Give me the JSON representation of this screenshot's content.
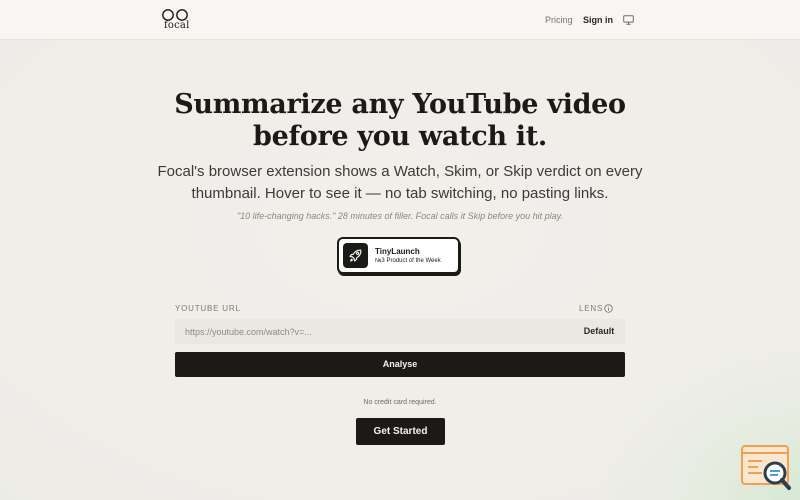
{
  "header": {
    "logo_text": "focal",
    "nav": {
      "pricing": "Pricing",
      "sign_in": "Sign in"
    },
    "theme_icon": "monitor-icon"
  },
  "hero": {
    "headline_line1": "Summarize any YouTube video",
    "headline_line2": "before you watch it.",
    "subhead_line1": "Focal's browser extension shows a Watch, Skim, or Skip verdict on every",
    "subhead_line2": "thumbnail. Hover to see it — no tab switching, no pasting links.",
    "quote": "\"10 life-changing hacks.\" 28 minutes of filler. Focal calls it Skip before you hit play."
  },
  "badge": {
    "title": "TinyLaunch",
    "subtitle": "№3 Product of the Week",
    "icon": "rocket-icon"
  },
  "form": {
    "url_label": "YOUTUBE URL",
    "url_placeholder": "https://youtube.com/watch?v=...",
    "url_value": "",
    "lens_label": "LENS",
    "lens_value": "Default",
    "analyse_label": "Analyse"
  },
  "cta": {
    "note": "No credit card required.",
    "button_label": "Get Started"
  },
  "colors": {
    "ink": "#1c1a17",
    "background": "#f0eee9",
    "input_bg": "#eae8e2",
    "muted": "#7d7a72",
    "widget_accent": "#f0a050"
  }
}
